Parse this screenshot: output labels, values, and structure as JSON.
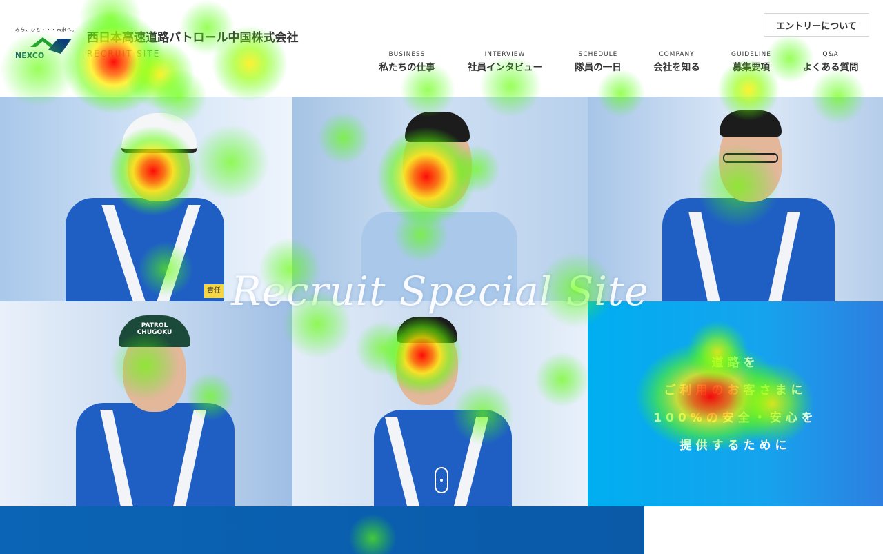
{
  "header": {
    "logo_tagline": "みち、ひと・・・未来へ。",
    "logo_brand": "NEXCO",
    "company_name": "西日本高速道路パトロール中国株式会社",
    "site_subtitle": "RECRUIT SITE",
    "entry_button": "エントリーについて"
  },
  "nav": [
    {
      "en": "BUSINESS",
      "ja": "私たちの仕事"
    },
    {
      "en": "INTERVIEW",
      "ja": "社員インタビュー"
    },
    {
      "en": "SCHEDULE",
      "ja": "隊員の一日"
    },
    {
      "en": "COMPANY",
      "ja": "会社を知る"
    },
    {
      "en": "GUIDELINE",
      "ja": "募集要項"
    },
    {
      "en": "Q&A",
      "ja": "よくある質問"
    }
  ],
  "hero": {
    "script_title": "Recruit Special Site",
    "message_lines": [
      "道路を",
      "ご利用のお客さまに",
      "100%の安全・安心を",
      "提供するために"
    ],
    "cap_text": "PATROL CHUGOKU",
    "badge_text": "責任"
  },
  "colors": {
    "brand_green": "#1a8f3c",
    "brand_navy": "#0d3b7a",
    "uniform_blue": "#1f5fc4",
    "panel_blue": "#12a8ef",
    "band_blue": "#0a5ea9"
  }
}
